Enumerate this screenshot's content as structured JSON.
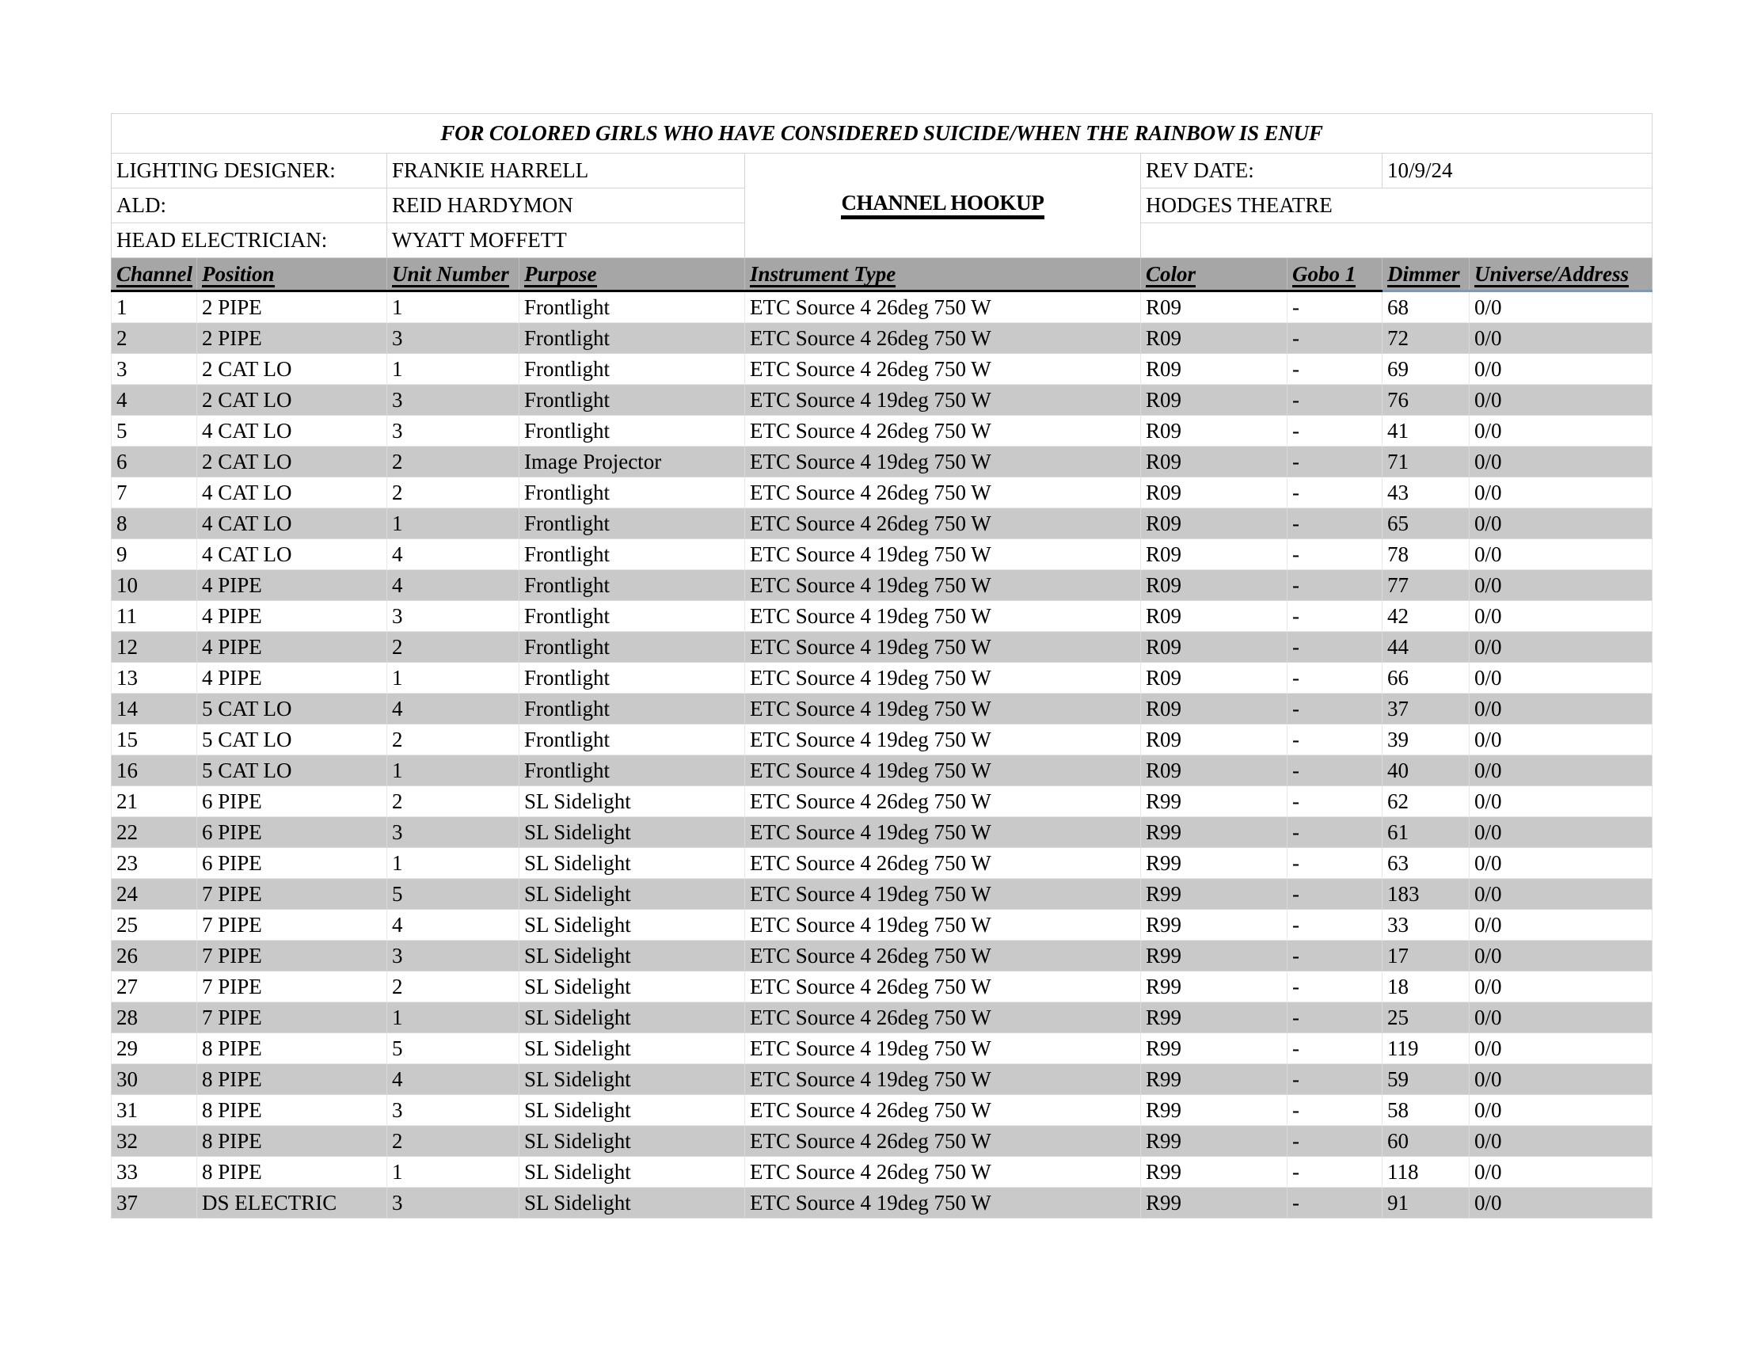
{
  "document": {
    "title": "FOR COLORED GIRLS WHO HAVE CONSIDERED SUICIDE/WHEN THE RAINBOW IS ENUF",
    "doc_type": "CHANNEL HOOKUP",
    "blank": ""
  },
  "info": {
    "lighting_designer_label": "LIGHTING DESIGNER:",
    "lighting_designer_value": "FRANKIE HARRELL",
    "ald_label": "ALD:",
    "ald_value": "REID HARDYMON",
    "head_electrician_label": "HEAD ELECTRICIAN:",
    "head_electrician_value": "WYATT MOFFETT",
    "rev_date_label": "REV DATE:",
    "rev_date_value": "10/9/24",
    "venue": "HODGES THEATRE"
  },
  "table": {
    "columns": [
      "Channel",
      "Position",
      "Unit Number",
      "Purpose",
      "Instrument Type",
      "Color",
      "Gobo 1",
      "Dimmer",
      "Universe/Address"
    ],
    "rows": [
      {
        "channel": "1",
        "position": "2 PIPE",
        "unit": "1",
        "purpose": "Frontlight",
        "instrument": "ETC Source 4 26deg 750 W",
        "color": "R09",
        "gobo": "-",
        "dimmer": "68",
        "universe": "0/0"
      },
      {
        "channel": "2",
        "position": "2 PIPE",
        "unit": "3",
        "purpose": "Frontlight",
        "instrument": "ETC Source 4 26deg 750 W",
        "color": "R09",
        "gobo": "-",
        "dimmer": "72",
        "universe": "0/0"
      },
      {
        "channel": "3",
        "position": "2 CAT LO",
        "unit": "1",
        "purpose": "Frontlight",
        "instrument": "ETC Source 4 26deg 750 W",
        "color": "R09",
        "gobo": "-",
        "dimmer": "69",
        "universe": "0/0"
      },
      {
        "channel": "4",
        "position": "2 CAT LO",
        "unit": "3",
        "purpose": "Frontlight",
        "instrument": "ETC Source 4 19deg 750 W",
        "color": "R09",
        "gobo": "-",
        "dimmer": "76",
        "universe": "0/0"
      },
      {
        "channel": "5",
        "position": "4 CAT LO",
        "unit": "3",
        "purpose": "Frontlight",
        "instrument": "ETC Source 4 26deg 750 W",
        "color": "R09",
        "gobo": "-",
        "dimmer": "41",
        "universe": "0/0"
      },
      {
        "channel": "6",
        "position": "2 CAT LO",
        "unit": "2",
        "purpose": "Image Projector",
        "instrument": "ETC Source 4 19deg 750 W",
        "color": "R09",
        "gobo": "-",
        "dimmer": "71",
        "universe": "0/0"
      },
      {
        "channel": "7",
        "position": "4 CAT LO",
        "unit": "2",
        "purpose": "Frontlight",
        "instrument": "ETC Source 4 26deg 750 W",
        "color": "R09",
        "gobo": "-",
        "dimmer": "43",
        "universe": "0/0"
      },
      {
        "channel": "8",
        "position": "4 CAT LO",
        "unit": "1",
        "purpose": "Frontlight",
        "instrument": "ETC Source 4 26deg 750 W",
        "color": "R09",
        "gobo": "-",
        "dimmer": "65",
        "universe": "0/0"
      },
      {
        "channel": "9",
        "position": "4 CAT LO",
        "unit": "4",
        "purpose": "Frontlight",
        "instrument": "ETC Source 4 19deg 750 W",
        "color": "R09",
        "gobo": "-",
        "dimmer": "78",
        "universe": "0/0"
      },
      {
        "channel": "10",
        "position": "4 PIPE",
        "unit": "4",
        "purpose": "Frontlight",
        "instrument": "ETC Source 4 19deg 750 W",
        "color": "R09",
        "gobo": "-",
        "dimmer": "77",
        "universe": "0/0"
      },
      {
        "channel": "11",
        "position": "4 PIPE",
        "unit": "3",
        "purpose": "Frontlight",
        "instrument": "ETC Source 4 19deg 750 W",
        "color": "R09",
        "gobo": "-",
        "dimmer": "42",
        "universe": "0/0"
      },
      {
        "channel": "12",
        "position": "4 PIPE",
        "unit": "2",
        "purpose": "Frontlight",
        "instrument": "ETC Source 4 19deg 750 W",
        "color": "R09",
        "gobo": "-",
        "dimmer": "44",
        "universe": "0/0"
      },
      {
        "channel": "13",
        "position": "4 PIPE",
        "unit": "1",
        "purpose": "Frontlight",
        "instrument": "ETC Source 4 19deg 750 W",
        "color": "R09",
        "gobo": "-",
        "dimmer": "66",
        "universe": "0/0"
      },
      {
        "channel": "14",
        "position": "5 CAT LO",
        "unit": "4",
        "purpose": "Frontlight",
        "instrument": "ETC Source 4 19deg 750 W",
        "color": "R09",
        "gobo": "-",
        "dimmer": "37",
        "universe": "0/0"
      },
      {
        "channel": "15",
        "position": "5 CAT LO",
        "unit": "2",
        "purpose": "Frontlight",
        "instrument": "ETC Source 4 19deg 750 W",
        "color": "R09",
        "gobo": "-",
        "dimmer": "39",
        "universe": "0/0"
      },
      {
        "channel": "16",
        "position": "5 CAT LO",
        "unit": "1",
        "purpose": "Frontlight",
        "instrument": "ETC Source 4 19deg 750 W",
        "color": "R09",
        "gobo": "-",
        "dimmer": "40",
        "universe": "0/0"
      },
      {
        "channel": "21",
        "position": "6 PIPE",
        "unit": "2",
        "purpose": "SL Sidelight",
        "instrument": "ETC Source 4 26deg 750 W",
        "color": "R99",
        "gobo": "-",
        "dimmer": "62",
        "universe": "0/0"
      },
      {
        "channel": "22",
        "position": "6 PIPE",
        "unit": "3",
        "purpose": "SL Sidelight",
        "instrument": "ETC Source 4 19deg 750 W",
        "color": "R99",
        "gobo": "-",
        "dimmer": "61",
        "universe": "0/0"
      },
      {
        "channel": "23",
        "position": "6 PIPE",
        "unit": "1",
        "purpose": "SL Sidelight",
        "instrument": "ETC Source 4 26deg 750 W",
        "color": "R99",
        "gobo": "-",
        "dimmer": "63",
        "universe": "0/0"
      },
      {
        "channel": "24",
        "position": "7 PIPE",
        "unit": "5",
        "purpose": "SL Sidelight",
        "instrument": "ETC Source 4 19deg 750 W",
        "color": "R99",
        "gobo": "-",
        "dimmer": "183",
        "universe": "0/0"
      },
      {
        "channel": "25",
        "position": "7 PIPE",
        "unit": "4",
        "purpose": "SL Sidelight",
        "instrument": "ETC Source 4 19deg 750 W",
        "color": "R99",
        "gobo": "-",
        "dimmer": "33",
        "universe": "0/0"
      },
      {
        "channel": "26",
        "position": "7 PIPE",
        "unit": "3",
        "purpose": "SL Sidelight",
        "instrument": "ETC Source 4 26deg 750 W",
        "color": "R99",
        "gobo": "-",
        "dimmer": "17",
        "universe": "0/0"
      },
      {
        "channel": "27",
        "position": "7 PIPE",
        "unit": "2",
        "purpose": "SL Sidelight",
        "instrument": "ETC Source 4 26deg 750 W",
        "color": "R99",
        "gobo": "-",
        "dimmer": "18",
        "universe": "0/0"
      },
      {
        "channel": "28",
        "position": "7 PIPE",
        "unit": "1",
        "purpose": "SL Sidelight",
        "instrument": "ETC Source 4 26deg 750 W",
        "color": "R99",
        "gobo": "-",
        "dimmer": "25",
        "universe": "0/0"
      },
      {
        "channel": "29",
        "position": "8 PIPE",
        "unit": "5",
        "purpose": "SL Sidelight",
        "instrument": "ETC Source 4 19deg 750 W",
        "color": "R99",
        "gobo": "-",
        "dimmer": "119",
        "universe": "0/0"
      },
      {
        "channel": "30",
        "position": "8 PIPE",
        "unit": "4",
        "purpose": "SL Sidelight",
        "instrument": "ETC Source 4 19deg 750 W",
        "color": "R99",
        "gobo": "-",
        "dimmer": "59",
        "universe": "0/0"
      },
      {
        "channel": "31",
        "position": "8 PIPE",
        "unit": "3",
        "purpose": "SL Sidelight",
        "instrument": "ETC Source 4 26deg 750 W",
        "color": "R99",
        "gobo": "-",
        "dimmer": "58",
        "universe": "0/0"
      },
      {
        "channel": "32",
        "position": "8 PIPE",
        "unit": "2",
        "purpose": "SL Sidelight",
        "instrument": "ETC Source 4 26deg 750 W",
        "color": "R99",
        "gobo": "-",
        "dimmer": "60",
        "universe": "0/0"
      },
      {
        "channel": "33",
        "position": "8 PIPE",
        "unit": "1",
        "purpose": "SL Sidelight",
        "instrument": "ETC Source 4 26deg 750 W",
        "color": "R99",
        "gobo": "-",
        "dimmer": "118",
        "universe": "0/0"
      },
      {
        "channel": "37",
        "position": "DS ELECTRIC",
        "unit": "3",
        "purpose": "SL Sidelight",
        "instrument": "ETC Source 4 19deg 750 W",
        "color": "R99",
        "gobo": "-",
        "dimmer": "91",
        "universe": "0/0"
      }
    ]
  },
  "colors": {
    "header_band": "#a6a6a6",
    "row_shade": "#c9c9c9",
    "grid_line": "#d4d4d4",
    "accent_blue": "#8497b0"
  }
}
